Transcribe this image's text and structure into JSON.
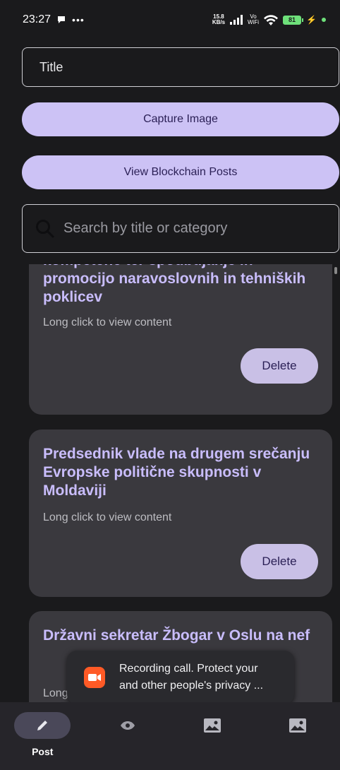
{
  "status_bar": {
    "time": "23:27",
    "speed_value": "15.8",
    "speed_unit": "KB/s",
    "vo_label": "Vo",
    "wifi_label": "WiFi",
    "battery": "81"
  },
  "form": {
    "title_value": "Title",
    "capture_label": "Capture Image",
    "view_label": "View Blockchain Posts",
    "search_placeholder": "Search by title or category"
  },
  "posts": [
    {
      "title": "kompetenc ter spodbujanje in promocijo naravoslovnih in tehniških poklicev",
      "hint": "Long click to view content",
      "delete_label": "Delete"
    },
    {
      "title": "Predsednik vlade na drugem srečanju Evropske politične skupnosti v Moldaviji",
      "hint": "Long click to view content",
      "delete_label": "Delete"
    },
    {
      "title": "Državni sekretar Žbogar v Oslu na nef",
      "hint": "Long"
    }
  ],
  "snackbar": {
    "line1": "Recording call. Protect your",
    "line2": "and other people's privacy ..."
  },
  "nav": {
    "post_label": "Post"
  },
  "colors": {
    "accent": "#ccc2f5",
    "background": "#1a1a1c",
    "card": "#3a393e",
    "card_title": "#c9bdfc",
    "record": "#ff5a26"
  },
  "icons": [
    "chat-icon",
    "more-icon",
    "signal-icon",
    "wifi-icon",
    "battery-icon",
    "charging-icon",
    "search-icon",
    "record-icon",
    "pencil-icon",
    "eye-icon",
    "image-icon",
    "image-icon"
  ]
}
